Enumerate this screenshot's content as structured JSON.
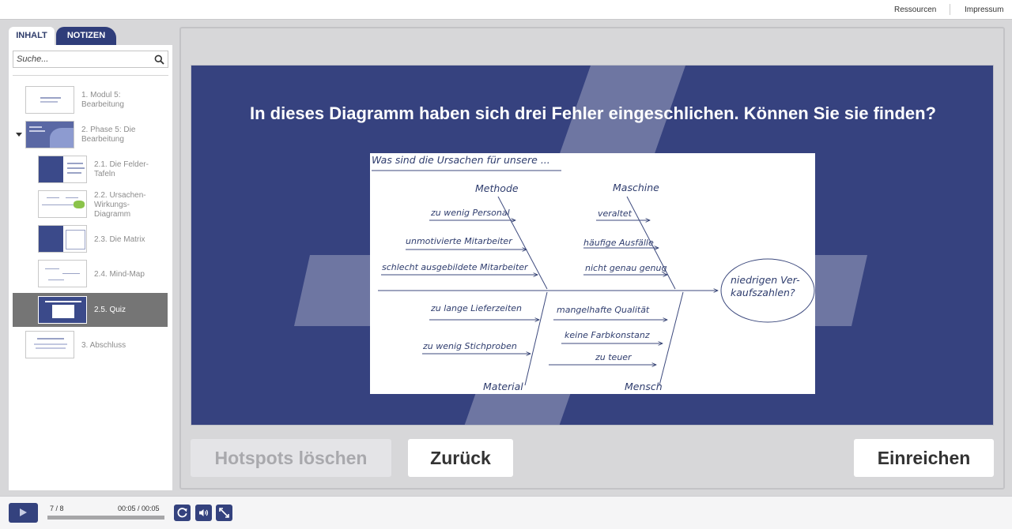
{
  "topbar": {
    "resources": "Ressourcen",
    "imprint": "Impressum"
  },
  "sidebar": {
    "tabs": {
      "contents": "INHALT",
      "notes": "NOTIZEN"
    },
    "search_placeholder": "Suche...",
    "items": [
      {
        "label": "1. Modul 5:\nBearbeitung",
        "icon": "slide-thumbnail"
      },
      {
        "label": "2. Phase 5: Die\nBearbeitung",
        "icon": "slide-thumbnail"
      },
      {
        "label": "2.1. Die Felder-\nTafeln",
        "icon": "slide-thumbnail"
      },
      {
        "label": "2.2. Ursachen-\nWirkungs-\nDiagramm",
        "icon": "slide-thumbnail"
      },
      {
        "label": "2.3. Die Matrix",
        "icon": "slide-thumbnail"
      },
      {
        "label": "2.4. Mind-Map",
        "icon": "slide-thumbnail"
      },
      {
        "label": "2.5. Quiz",
        "icon": "slide-thumbnail",
        "active": true
      },
      {
        "label": "3. Abschluss",
        "icon": "slide-thumbnail"
      }
    ]
  },
  "slide": {
    "title": "In dieses Diagramm haben sich drei Fehler eingeschlichen. Können Sie sie finden?",
    "diagram": {
      "heading": "Was sind die Ursachen für unsere ...",
      "categories": {
        "method": "Methode",
        "machine": "Maschine",
        "material": "Material",
        "human": "Mensch"
      },
      "method_causes": [
        "zu wenig Personal",
        "unmotivierte Mitarbeiter",
        "schlecht ausgebildete Mitarbeiter"
      ],
      "machine_causes": [
        "veraltet",
        "häufige Ausfälle",
        "nicht genau genug"
      ],
      "material_causes": [
        "zu lange Lieferzeiten",
        "zu wenig Stichproben"
      ],
      "human_causes": [
        "mangelhafte Qualität",
        "keine Farbkonstanz",
        "zu teuer"
      ],
      "effect": "niedrigen Ver-\nkaufszahlen?"
    }
  },
  "buttons": {
    "clear": "Hotspots löschen",
    "back": "Zurück",
    "submit": "Einreichen"
  },
  "player": {
    "slide_count": "7 / 8",
    "time": "00:05 / 00:05",
    "progress_percent": 100,
    "colors": {
      "accent": "#34427e"
    }
  }
}
